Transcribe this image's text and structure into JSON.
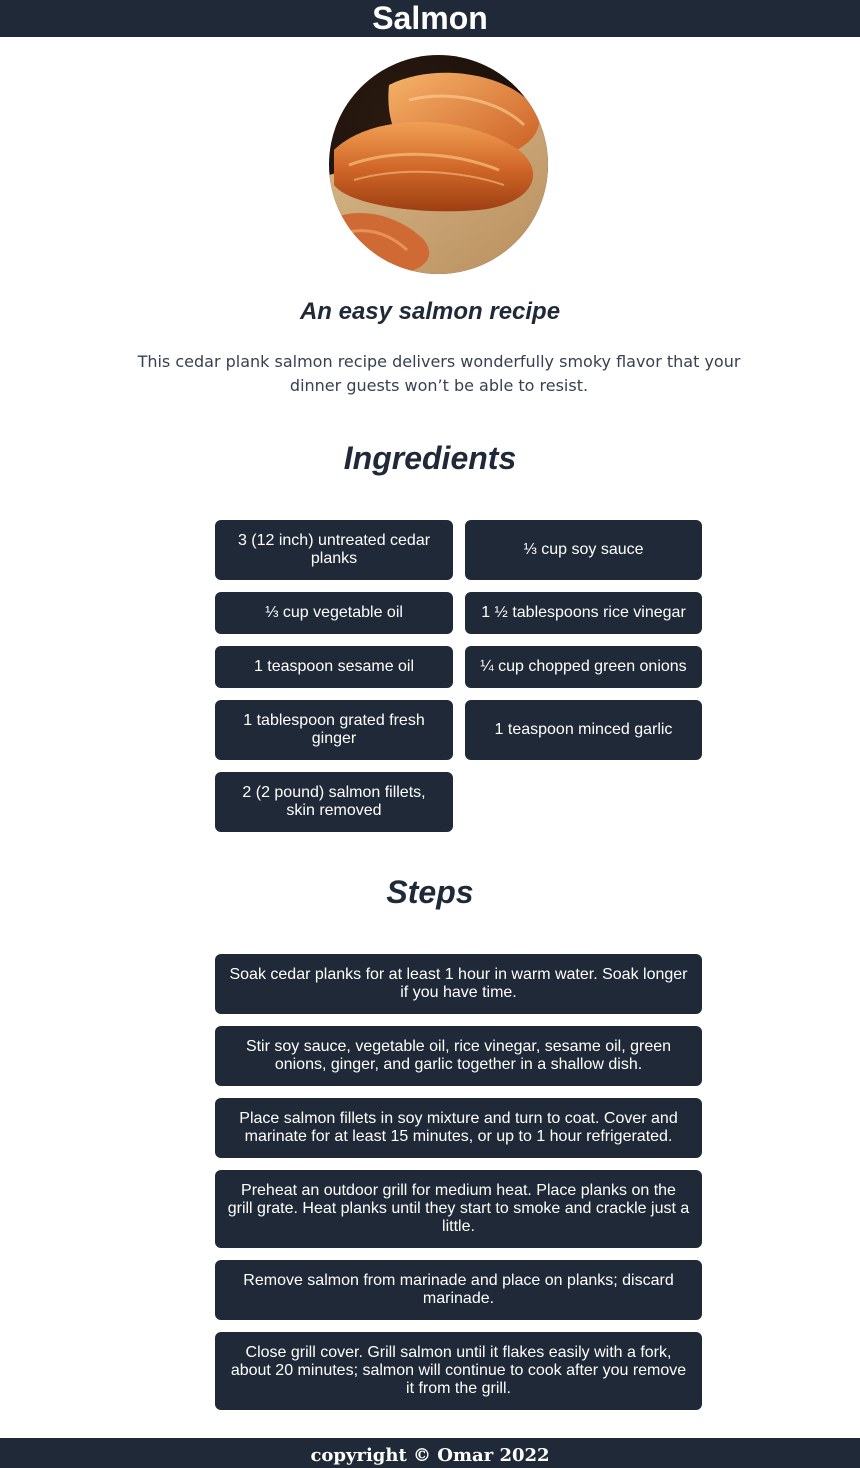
{
  "header": {
    "title": "Salmon"
  },
  "hero": {
    "image_alt": "Cedar plank salmon fillets"
  },
  "subtitle": "An easy salmon recipe",
  "intro": "This cedar plank salmon recipe delivers wonderfully smoky flavor that your dinner guests won’t be able to resist.",
  "ingredients": {
    "title": "Ingredients",
    "items": [
      "3 (12 inch) untreated cedar planks",
      "⅓ cup soy sauce",
      "⅓ cup vegetable oil",
      "1 ½ tablespoons rice vinegar",
      "1 teaspoon sesame oil",
      "¼ cup chopped green onions",
      "1 tablespoon grated fresh ginger",
      "1 teaspoon minced garlic",
      "2 (2 pound) salmon fillets, skin removed"
    ]
  },
  "steps": {
    "title": "Steps",
    "items": [
      "Soak cedar planks for at least 1 hour in warm water. Soak longer if you have time.",
      "Stir soy sauce, vegetable oil, rice vinegar, sesame oil, green onions, ginger, and garlic together in a shallow dish.",
      "Place salmon fillets in soy mixture and turn to coat. Cover and marinate for at least 15 minutes, or up to 1 hour refrigerated.",
      "Preheat an outdoor grill for medium heat. Place planks on the grill grate. Heat planks until they start to smoke and crackle just a little.",
      "Remove salmon from marinade and place on planks; discard marinade.",
      "Close grill cover. Grill salmon until it flakes easily with a fork, about 20 minutes; salmon will continue to cook after you remove it from the grill."
    ]
  },
  "footer": {
    "text": "copyright © Omar 2022"
  },
  "colors": {
    "primary": "#1f2937",
    "card_text": "#ffffff",
    "background": "#ffffff"
  }
}
